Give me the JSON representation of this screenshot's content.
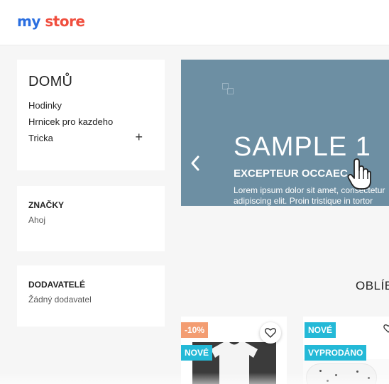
{
  "header": {
    "logo_part1": "my",
    "logo_part2": "store",
    "brand_colors": {
      "blue": "#2a6ee0",
      "red": "#f04e3e"
    }
  },
  "categories": {
    "title": "DOMŮ",
    "items": [
      {
        "label": "Hodinky"
      },
      {
        "label": "Hrnicek pro kazdeho"
      },
      {
        "label": "Tricka",
        "expandable": true,
        "icon": "plus-icon"
      }
    ]
  },
  "brands": {
    "title": "ZNAČKY",
    "value": "Ahoj"
  },
  "suppliers": {
    "title": "DODAVATELÉ",
    "value": "Žádný dodavatel"
  },
  "hero": {
    "title": "SAMPLE 1",
    "subtitle": "EXCEPTEUR OCCAEC",
    "text_line1": "Lorem ipsum dolor sit amet, consectetur",
    "text_line2": "adipiscing elit. Proin tristique in tortor",
    "prev_icon": "chevron-left-icon",
    "background_color": "#6d8fa3"
  },
  "popular": {
    "title": "OBLÍB"
  },
  "products": [
    {
      "discount": "-10%",
      "badges": [
        "NOVÉ"
      ],
      "wishlist_icon": "heart-icon"
    },
    {
      "badges": [
        "NOVÉ",
        "VYPRODÁNO"
      ],
      "wishlist_icon": "heart-icon"
    }
  ],
  "colors": {
    "badge_new": "#24b9d7",
    "badge_discount": "#f39d72"
  }
}
